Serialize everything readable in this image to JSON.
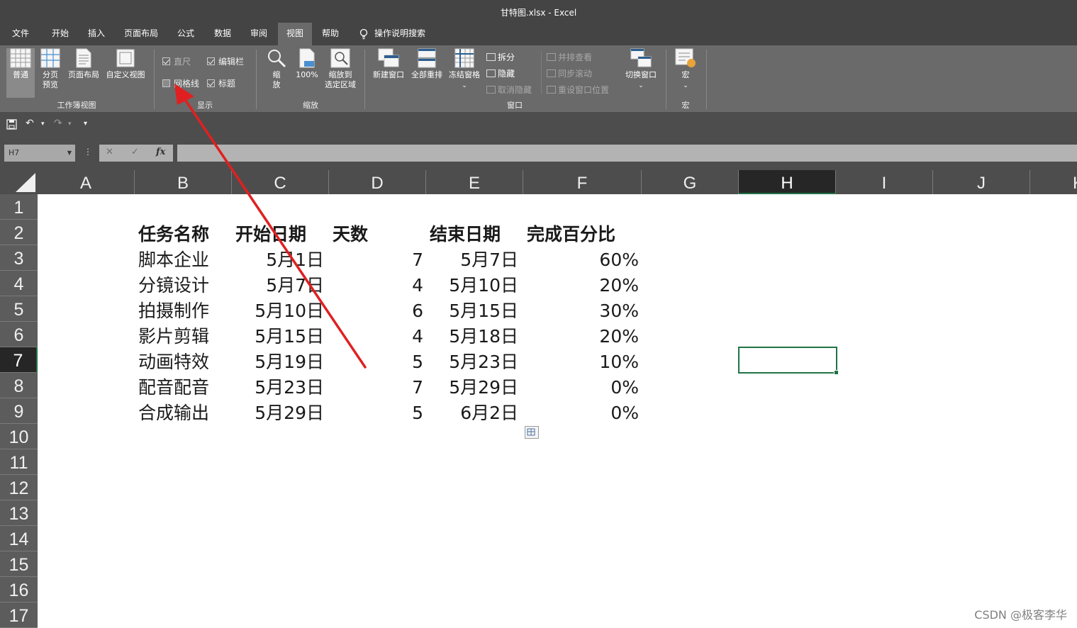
{
  "window": {
    "title": "甘特图.xlsx  -  Excel"
  },
  "tabs": [
    "文件",
    "开始",
    "插入",
    "页面布局",
    "公式",
    "数据",
    "审阅",
    "视图",
    "帮助"
  ],
  "tell_me": "操作说明搜索",
  "active_tab": "视图",
  "ribbon": {
    "workbook_views": {
      "group": "工作簿视图",
      "normal": "普通",
      "page_break_line1": "分页",
      "page_break_line2": "预览",
      "page_layout": "页面布局",
      "custom_views": "自定义视图"
    },
    "show": {
      "group": "显示",
      "ruler": "直尺",
      "formula_bar": "编辑栏",
      "gridlines": "网格线",
      "headings": "标题"
    },
    "zoom": {
      "group": "缩放",
      "zoom_line1": "缩",
      "zoom_line2": "放",
      "zoom100": "100%",
      "zoom_sel_line1": "缩放到",
      "zoom_sel_line2": "选定区域"
    },
    "window": {
      "group": "窗口",
      "new_window": "新建窗口",
      "arrange_all": "全部重排",
      "freeze": "冻结窗格",
      "split": "拆分",
      "hide": "隐藏",
      "unhide": "取消隐藏",
      "side_by_side": "并排查看",
      "sync_scroll": "同步滚动",
      "reset_pos": "重设窗口位置",
      "switch": "切换窗口"
    },
    "macros": {
      "group": "宏",
      "macros": "宏"
    }
  },
  "formula_bar": {
    "name_box": "H7",
    "fx": "fx",
    "cancel": "✕",
    "enter": "✓",
    "content": ""
  },
  "columns": [
    "A",
    "B",
    "C",
    "D",
    "E",
    "F",
    "G",
    "H",
    "I",
    "J",
    "K"
  ],
  "rows": [
    "1",
    "2",
    "3",
    "4",
    "5",
    "6",
    "7",
    "8",
    "9",
    "10",
    "11",
    "12",
    "13",
    "14",
    "15",
    "16",
    "17"
  ],
  "selected_cell": "H7",
  "table": {
    "headers": [
      "任务名称",
      "开始日期",
      "天数",
      "结束日期",
      "完成百分比"
    ],
    "rows": [
      [
        "脚本企业",
        "5月1日",
        "7",
        "5月7日",
        "60%"
      ],
      [
        "分镜设计",
        "5月7日",
        "4",
        "5月10日",
        "20%"
      ],
      [
        "拍摄制作",
        "5月10日",
        "6",
        "5月15日",
        "30%"
      ],
      [
        "影片剪辑",
        "5月15日",
        "4",
        "5月18日",
        "20%"
      ],
      [
        "动画特效",
        "5月19日",
        "5",
        "5月23日",
        "10%"
      ],
      [
        "配音配音",
        "5月23日",
        "7",
        "5月29日",
        "0%"
      ],
      [
        "合成输出",
        "5月29日",
        "5",
        "6月2日",
        "0%"
      ]
    ]
  },
  "watermark": "CSDN @极客李华",
  "colors": {
    "title_bg": "#444444",
    "ribbon_bg": "#6a6a6a",
    "accent": "#217346",
    "annotation_arrow": "#e02020"
  }
}
